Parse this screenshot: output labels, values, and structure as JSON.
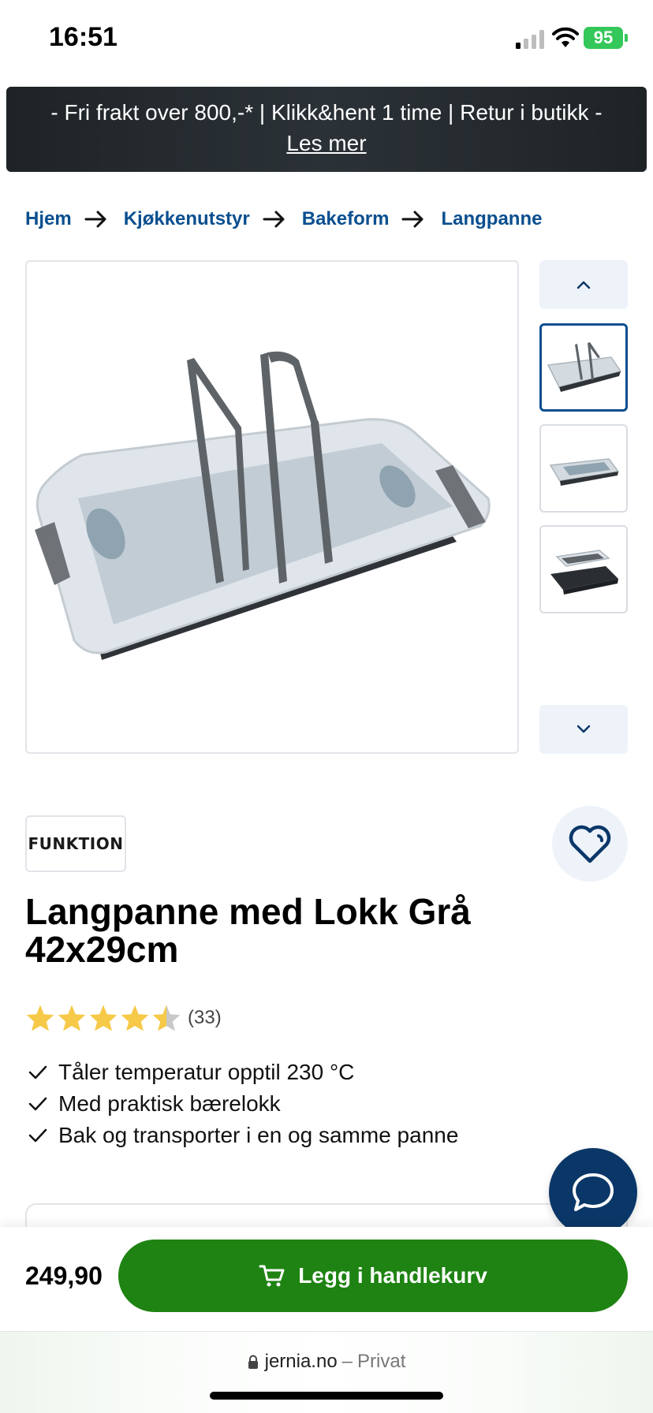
{
  "status_bar": {
    "time": "16:51",
    "battery": "95"
  },
  "promo": {
    "text": "- Fri frakt over 800,-* | Klikk&hent 1 time | Retur i butikk -",
    "link": "Les mer"
  },
  "breadcrumb": [
    "Hjem",
    "Kjøkkenutstyr",
    "Bakeform",
    "Langpanne"
  ],
  "gallery": {
    "thumbnails": 3,
    "active_index": 0
  },
  "brand": {
    "name": "FUNKTION"
  },
  "product": {
    "title": "Langpanne med Lokk Grå 42x29cm",
    "rating": 4.5,
    "review_count": "(33)",
    "usps": [
      "Tåler temperatur opptil 230 °C",
      "Med praktisk bærelokk",
      "Bak og transporter i en og samme panne"
    ],
    "price": "249,90"
  },
  "cart": {
    "add_label": "Legg i handlekurv"
  },
  "browser": {
    "domain": "jernia.no",
    "separator": "–",
    "mode": "Privat"
  },
  "colors": {
    "brand_blue": "#0a4f8f",
    "cart_green": "#1e8312",
    "chat_navy": "#0a3768",
    "star": "#f7c948"
  },
  "icons": [
    "signal-icon",
    "wifi-icon",
    "battery-icon",
    "arrow-right-icon",
    "chevron-up-icon",
    "chevron-down-icon",
    "heart-icon",
    "star-icon",
    "check-icon",
    "chat-icon",
    "cart-icon",
    "lock-icon"
  ]
}
